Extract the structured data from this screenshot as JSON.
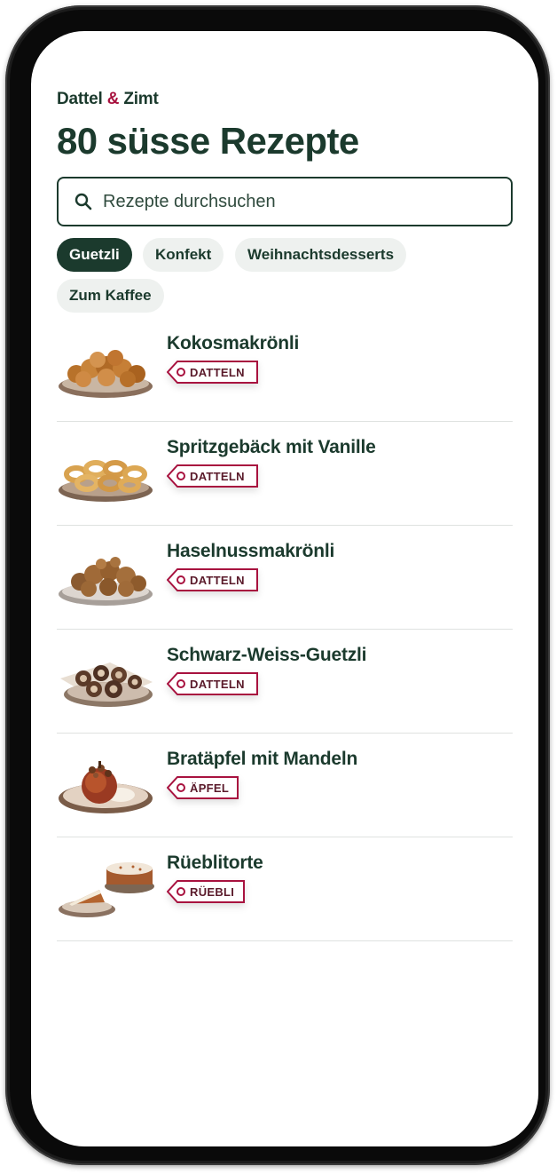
{
  "app": {
    "brand_part1": "Dattel",
    "brand_amp": "&",
    "brand_part2": "Zimt",
    "title": "80 süsse Rezepte"
  },
  "search": {
    "placeholder": "Rezepte durchsuchen",
    "icon": "search-icon"
  },
  "filters": [
    {
      "label": "Guetzli",
      "active": true
    },
    {
      "label": "Konfekt",
      "active": false
    },
    {
      "label": "Weihnachtsdesserts",
      "active": false
    },
    {
      "label": "Zum Kaffee",
      "active": false
    }
  ],
  "recipes": [
    {
      "title": "Kokosmakrönli",
      "tag": "DATTELN"
    },
    {
      "title": "Spritzgebäck mit Vanille",
      "tag": "DATTELN"
    },
    {
      "title": "Haselnussmakrönli",
      "tag": "DATTELN"
    },
    {
      "title": "Schwarz-Weiss-Guetzli",
      "tag": "DATTELN"
    },
    {
      "title": "Bratäpfel mit Mandeln",
      "tag": "ÄPFEL"
    },
    {
      "title": "Rüeblitorte",
      "tag": "RÜEBLI"
    }
  ],
  "colors": {
    "primary": "#1b3a2d",
    "accent": "#a8123f",
    "chip_bg": "#eef1ef",
    "tag_text": "#5a1a2a"
  }
}
